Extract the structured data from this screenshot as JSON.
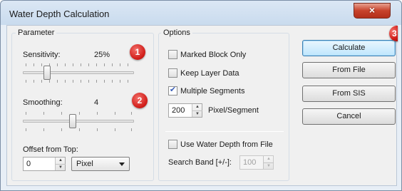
{
  "window": {
    "title": "Water Depth Calculation",
    "close_glyph": "×"
  },
  "parameter": {
    "legend": "Parameter",
    "sensitivity_label": "Sensitivity:",
    "sensitivity_value": "25%",
    "sensitivity_level": 0.25,
    "smoothing_label": "Smoothing:",
    "smoothing_value": "4",
    "offset_label": "Offset from Top:",
    "offset_value": "0",
    "unit_selected": "Pixel"
  },
  "options": {
    "legend": "Options",
    "marked_block_only": {
      "label": "Marked Block Only",
      "checked": false
    },
    "keep_layer_data": {
      "label": "Keep Layer Data",
      "checked": false
    },
    "multiple_segments": {
      "label": "Multiple Segments",
      "checked": true
    },
    "pixel_segment_value": "200",
    "pixel_segment_label": "Pixel/Segment",
    "use_water_depth_from_file": {
      "label": "Use Water Depth from File",
      "checked": false
    },
    "search_band_label": "Search Band [+/-]:",
    "search_band_value": "100"
  },
  "buttons": {
    "calculate": "Calculate",
    "from_file": "From File",
    "from_sis": "From SIS",
    "cancel": "Cancel"
  },
  "badges": {
    "one": "1",
    "two": "2",
    "three": "3"
  },
  "icons": {
    "check_mark": "✔",
    "spin_up": "▲",
    "spin_down": "▼"
  },
  "colors": {
    "badge": "#d21f1b",
    "close_button": "#c7422b",
    "default_button_border": "#3c7fb1"
  }
}
